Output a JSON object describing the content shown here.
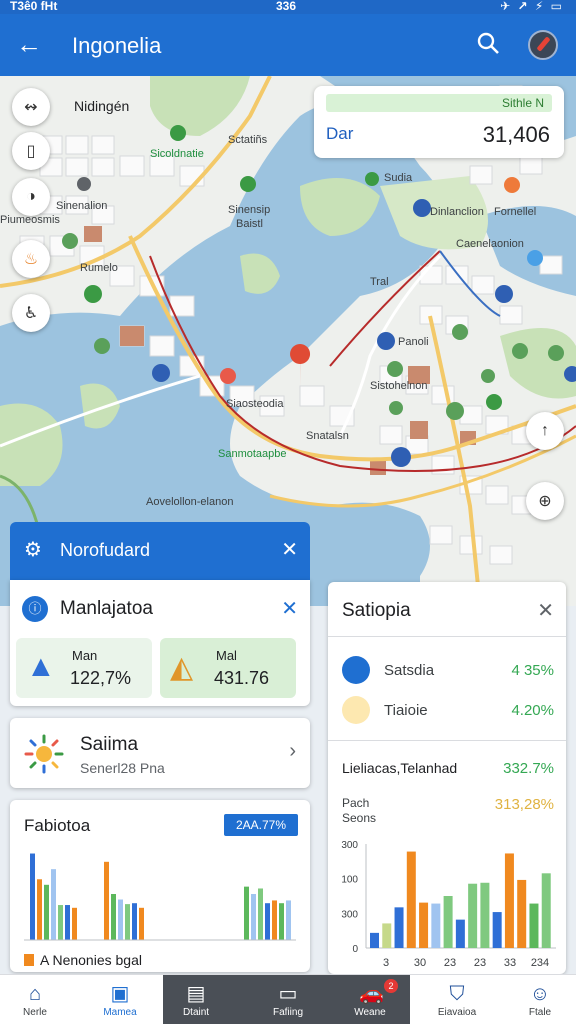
{
  "status_bar": {
    "time": "T3ê0 fHt",
    "center": "336",
    "icons": "✈ ↗ ⚡ ▭"
  },
  "app_bar": {
    "title": "Ingonelia"
  },
  "map": {
    "labels": [
      {
        "text": "Nidingén",
        "style": "big",
        "pos": "l1"
      },
      {
        "text": "Sicoldnatie",
        "style": "green",
        "pos": "l2"
      },
      {
        "text": "Sctatiñs",
        "style": "",
        "pos": "l3"
      },
      {
        "text": "Sinenalion",
        "style": "",
        "pos": "l4"
      },
      {
        "text": "Sinensip",
        "style": "",
        "pos": "l5"
      },
      {
        "text": "Baistl",
        "style": "",
        "pos": "l6"
      },
      {
        "text": "Sudia",
        "style": "",
        "pos": "l7"
      },
      {
        "text": "Rumelo",
        "style": "",
        "pos": "l8"
      },
      {
        "text": "Piumeosmis",
        "style": "",
        "pos": "l9"
      },
      {
        "text": "Dinlanclion",
        "style": "",
        "pos": "l10"
      },
      {
        "text": "Fornellel",
        "style": "",
        "pos": "l11"
      },
      {
        "text": "Caenelaonion",
        "style": "",
        "pos": "l12"
      },
      {
        "text": "Tral",
        "style": "",
        "pos": "l13"
      },
      {
        "text": "Panoli",
        "style": "",
        "pos": "l14"
      },
      {
        "text": "Sistohelnon",
        "style": "",
        "pos": "l15"
      },
      {
        "text": "Siaosteodia",
        "style": "",
        "pos": "l16"
      },
      {
        "text": "Snatalsn",
        "style": "",
        "pos": "l17"
      },
      {
        "text": "Sanmotaapbe",
        "style": "green",
        "pos": "l18"
      },
      {
        "text": "Aovelollon-elanon",
        "style": "",
        "pos": "l19"
      }
    ],
    "stat_card": {
      "tag": "Sithle N",
      "label": "Dar",
      "value": "31,406"
    }
  },
  "nordband": {
    "title": "Norofudard"
  },
  "manlajatoa": {
    "title": "Manlajatoa",
    "cards": [
      {
        "label": "Man",
        "value": "122,7%",
        "bg": "#eaf4ea"
      },
      {
        "label": "Mal",
        "value": "431.76",
        "bg": "#d9efd6"
      }
    ]
  },
  "salima": {
    "title": "Saiima",
    "subtitle": "Senerl28 Pna"
  },
  "fabiotoa": {
    "title": "Fabiotoa",
    "badge": "2AA.77%",
    "legend": "A Nenonies bgal",
    "chart_data": {
      "type": "bar",
      "series": [
        {
          "values": [
            94,
            66,
            60,
            77,
            38,
            38,
            35
          ]
        },
        {
          "values": [
            85,
            50,
            44,
            39,
            40,
            35
          ]
        },
        {
          "values": [
            58,
            50,
            56,
            40,
            43,
            40,
            43
          ]
        }
      ],
      "colors": [
        "#2f6fd6",
        "#f0891f",
        "#5cb85c",
        "#a0c4f0",
        "#7fc97f"
      ]
    }
  },
  "satiopia": {
    "title": "Satiopia",
    "rows": [
      {
        "label": "Satsdia",
        "value": "4 35%",
        "icon_color": "#1f6fd1"
      },
      {
        "label": "Tiaioie",
        "value": "4.20%",
        "icon_color": "#f6b73c"
      }
    ],
    "summary": {
      "label": "Lieliacas,Telanhad",
      "value": "332.7%"
    },
    "sub": {
      "line1": "Pach",
      "line2": "Seons",
      "value": "313,28%"
    },
    "chart_data": {
      "type": "bar",
      "y_ticks": [
        "300",
        "100",
        "300",
        "0"
      ],
      "x_ticks": [
        "3",
        "30",
        "23",
        "23",
        "33",
        "234"
      ],
      "values": [
        16,
        26,
        43,
        102,
        48,
        47,
        55,
        30,
        68,
        69,
        38,
        100,
        72,
        47,
        79
      ],
      "colors": [
        "#2f6fd6",
        "#c6d98a",
        "#2f6fd6",
        "#f0891f",
        "#f0891f",
        "#a0c4f0",
        "#7fc97f",
        "#2f6fd6",
        "#7fc97f",
        "#7fc97f",
        "#2f6fd6",
        "#f0891f",
        "#f0891f",
        "#5cb85c",
        "#7fc97f"
      ]
    }
  },
  "bottom_nav": [
    {
      "label": "Nerle",
      "id": "home",
      "dark": false,
      "active": false
    },
    {
      "label": "Mamea",
      "id": "map",
      "dark": false,
      "active": true
    },
    {
      "label": "Dtaint",
      "id": "doc",
      "dark": true,
      "active": false
    },
    {
      "label": "Fafiing",
      "id": "tv",
      "dark": true,
      "active": false
    },
    {
      "label": "Weane",
      "id": "car",
      "dark": true,
      "active": false,
      "badge": "2"
    },
    {
      "label": "Eiavaioa",
      "id": "shield",
      "dark": false,
      "active": false
    },
    {
      "label": "Ftale",
      "id": "profile",
      "dark": false,
      "active": false
    }
  ]
}
